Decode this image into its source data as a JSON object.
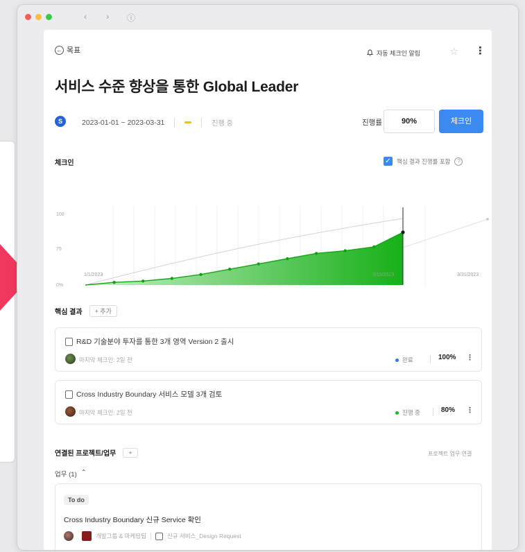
{
  "window": {
    "traffic_lights": [
      "#f25f58",
      "#f9be3e",
      "#3bc94b"
    ],
    "nav": {
      "back": "‹",
      "forward": "›",
      "info": "ⓘ"
    }
  },
  "header": {
    "back_label": "목표",
    "notify_label": "자동 체크인 알림",
    "star_icon": "☆",
    "more_icon": "⋮"
  },
  "objective": {
    "title": "서비스 수준 향상을 통한 Global Leader",
    "owner_initial": "S",
    "date_range": "2023-01-01 ~ 2023-03-31",
    "status": "진행 중",
    "progress_label": "진행률",
    "progress_value": "90%",
    "checkin_button": "체크인"
  },
  "checkin_section": {
    "title": "체크인",
    "toggle_label": "핵심 결과 진행률 포함",
    "toggle_checked": true
  },
  "chart_data": {
    "type": "area",
    "x_labels": [
      "1/1/2023",
      "3/15/2023",
      "3/31/2023"
    ],
    "y_ticks": [
      "100",
      "75",
      "0%"
    ],
    "x": [
      0,
      10,
      20,
      30,
      40,
      50,
      60,
      70,
      80,
      90,
      100
    ],
    "series": [
      {
        "values": [
          0,
          4,
          6,
          10,
          16,
          24,
          32,
          40,
          48,
          52,
          58,
          80
        ],
        "color": "#1fb51f"
      }
    ],
    "target_line": [
      0,
      100
    ],
    "current_marker_x": 100,
    "ylim": [
      0,
      120
    ],
    "grid": true
  },
  "key_results": {
    "title": "핵심 결과",
    "add_label": "+ 추가",
    "items": [
      {
        "title": "R&D 기술분야 투자를 통한 3개 영역 Version 2 출시",
        "meta": "마지막 체크인: 2일 전",
        "status": "완료",
        "status_color": "#2f7be8",
        "percent": "100%"
      },
      {
        "title": "Cross Industry Boundary 서비스 모델 3개 검토",
        "meta": "마지막 체크인: 2일 전",
        "status": "진행 중",
        "status_color": "#25b02f",
        "percent": "80%"
      }
    ]
  },
  "linked": {
    "title": "연결된 프로젝트/업무",
    "right_link": "프로젝트 업무 연결",
    "group_label": "업무 (1)",
    "task": {
      "tag": "To do",
      "title": "Cross Industry Boundary 신규 Service 확인",
      "meta_team": "개발그룹 & 마케팅팀",
      "meta_project": "신규 서비스_Design Request"
    }
  },
  "accent_color": "#3b8af0"
}
